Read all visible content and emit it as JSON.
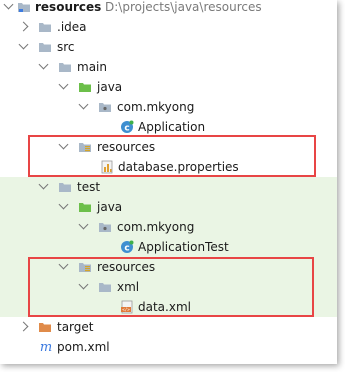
{
  "tree": {
    "root": {
      "label": "resources",
      "path": "D:\\projects\\java\\resources"
    },
    "idea": {
      "label": ".idea"
    },
    "src": {
      "label": "src"
    },
    "main": {
      "label": "main"
    },
    "main_java": {
      "label": "java"
    },
    "main_pkg": {
      "label": "com.mkyong"
    },
    "application": {
      "label": "Application"
    },
    "main_resources": {
      "label": "resources"
    },
    "database_properties": {
      "label": "database.properties"
    },
    "test": {
      "label": "test"
    },
    "test_java": {
      "label": "java"
    },
    "test_pkg": {
      "label": "com.mkyong"
    },
    "application_test": {
      "label": "ApplicationTest"
    },
    "test_resources": {
      "label": "resources"
    },
    "xml_folder": {
      "label": "xml"
    },
    "data_xml": {
      "label": "data.xml"
    },
    "target": {
      "label": "target"
    },
    "pom": {
      "label": "pom.xml"
    }
  },
  "colors": {
    "folder": "#a9b8c8",
    "source_folder": "#6cbf4a",
    "resources_folder": "#a9b8c8",
    "target_folder": "#e08b4a",
    "highlight": "#e84545",
    "test_background": "#eaf5e4"
  },
  "icons": {
    "module": "module-folder-icon",
    "folder": "folder-icon",
    "source": "source-folder-icon",
    "package": "package-icon",
    "class": "java-class-icon",
    "resources": "resources-folder-icon",
    "properties": "properties-file-icon",
    "xml": "xml-file-icon",
    "maven": "maven-icon"
  }
}
